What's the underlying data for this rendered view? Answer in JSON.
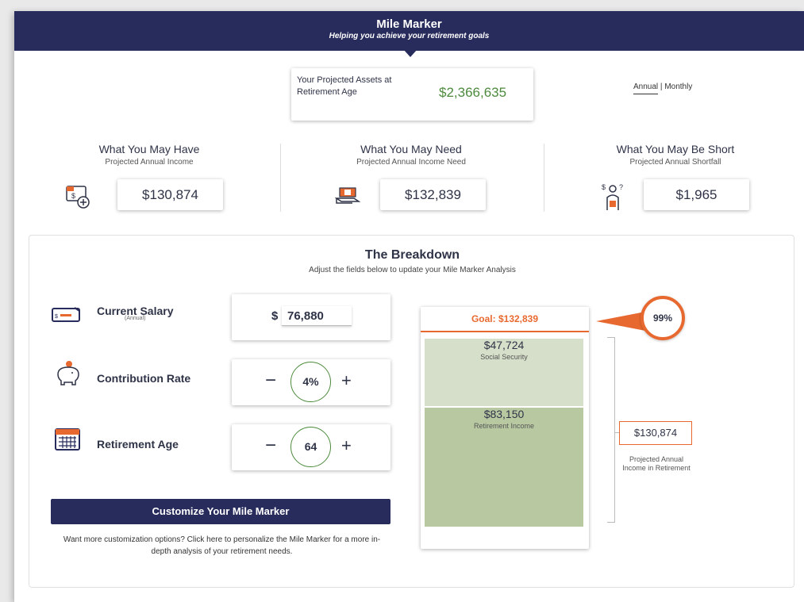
{
  "header": {
    "title": "Mile Marker",
    "subtitle": "Helping you achieve your retirement goals"
  },
  "assets": {
    "label": "Your Projected Assets at Retirement Age",
    "value": "$2,366,635"
  },
  "period": {
    "annual": "Annual",
    "separator": "|",
    "monthly": "Monthly"
  },
  "summary": [
    {
      "title": "What You May Have",
      "subtitle": "Projected Annual Income",
      "value": "$130,874",
      "icon": "income-icon"
    },
    {
      "title": "What You May Need",
      "subtitle": "Projected Annual Income Need",
      "value": "$132,839",
      "icon": "need-icon"
    },
    {
      "title": "What You May Be Short",
      "subtitle": "Projected Annual Shortfall",
      "value": "$1,965",
      "icon": "shortfall-icon"
    }
  ],
  "breakdown": {
    "title": "The Breakdown",
    "subtitle": "Adjust the fields below to update your Mile Marker Analysis",
    "salary": {
      "label": "Current Salary",
      "sublabel": "(Annual)",
      "currency": "$",
      "value": "76,880"
    },
    "contribution": {
      "label": "Contribution Rate",
      "value": "4%",
      "minus": "−",
      "plus": "+"
    },
    "retirement_age": {
      "label": "Retirement Age",
      "value": "64",
      "minus": "−",
      "plus": "+"
    },
    "customize_button": "Customize Your Mile Marker",
    "customize_text": "Want more customization options? Click here to personalize the Mile Marker for a more in-depth analysis of your retirement needs.",
    "goal": "Goal: $132,839",
    "percent": "99%",
    "social_security": {
      "value": "$47,724",
      "label": "Social Security"
    },
    "retirement_income": {
      "value": "$83,150",
      "label": "Retirement Income"
    },
    "projected_total": "$130,874",
    "projected_label": "Projected Annual Income in Retirement"
  },
  "colors": {
    "navy": "#282c5c",
    "green": "#4d8a3c",
    "orange": "#e8692f",
    "ss_fill": "#d6dfc9",
    "ri_fill": "#b8c9a2"
  }
}
